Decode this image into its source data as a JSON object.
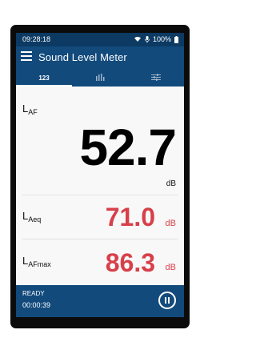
{
  "status": {
    "time": "09:28:18",
    "battery": "100%"
  },
  "app": {
    "title": "Sound Level Meter"
  },
  "tabs": [
    {
      "label": "123",
      "icon": "numeric"
    },
    {
      "label": "",
      "icon": "bar-chart-icon"
    },
    {
      "label": "",
      "icon": "sliders-icon"
    }
  ],
  "readings": {
    "laf": {
      "main": "L",
      "sub": "AF",
      "value": "52.7",
      "unit": "dB"
    },
    "laeq": {
      "main": "L",
      "sub": "Aeq",
      "value": "71.0",
      "unit": "dB"
    },
    "lafmax": {
      "main": "L",
      "sub": "AFmax",
      "value": "86.3",
      "unit": "dB"
    }
  },
  "footer": {
    "state": "READY",
    "elapsed": "00:00:39"
  },
  "colors": {
    "primary": "#124a7c",
    "status": "#0c3a63",
    "accent_red": "#d7404a"
  }
}
